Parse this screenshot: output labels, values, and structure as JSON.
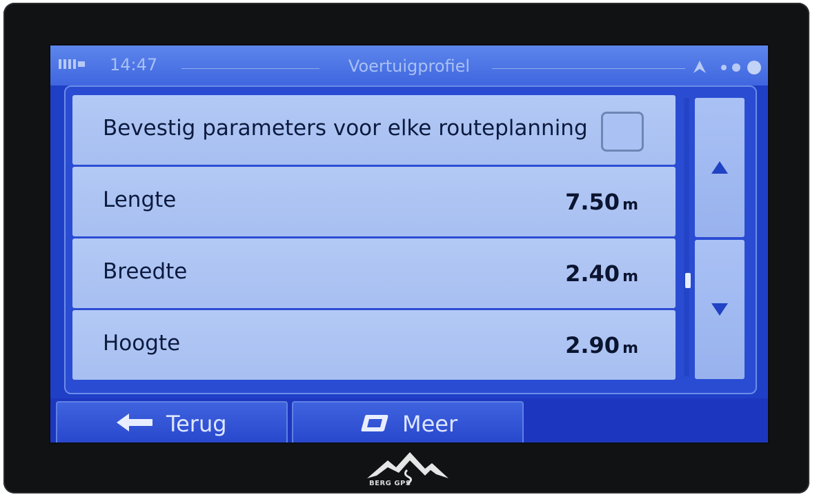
{
  "status": {
    "time": "14:47",
    "title": "Voertuigprofiel"
  },
  "rows": [
    {
      "label": "Bevestig parameters voor elke routeplanning",
      "checked": false
    },
    {
      "label": "Lengte",
      "value": "7.50",
      "unit": "m"
    },
    {
      "label": "Breedte",
      "value": "2.40",
      "unit": "m"
    },
    {
      "label": "Hoogte",
      "value": "2.90",
      "unit": "m"
    }
  ],
  "buttons": {
    "back": "Terug",
    "more": "Meer"
  },
  "brand": {
    "logo_text": "BERG GPS"
  },
  "icons": [
    "signal-icon",
    "gps-icon",
    "status-dots-icon",
    "scroll-up-icon",
    "scroll-down-icon",
    "back-arrow-icon",
    "more-icon",
    "mountain-logo-icon"
  ],
  "colors": {
    "background": "#1f3fc6",
    "row": "#afc6f4",
    "text": "#0c1a3e"
  }
}
